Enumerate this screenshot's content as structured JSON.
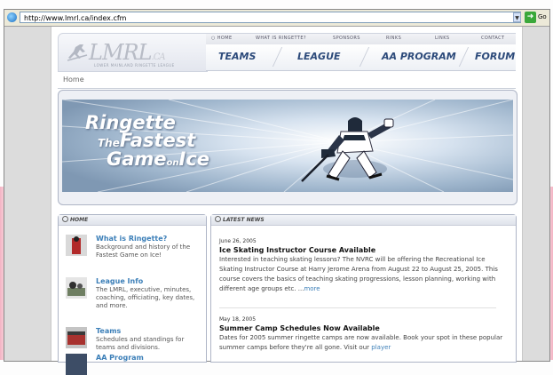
{
  "browser": {
    "address": "http://www.lmrl.ca/index.cfm",
    "go_label": "Go"
  },
  "header": {
    "logo_main": "LMRL",
    "logo_ca": ".CA",
    "logo_sub": "LOWER MAINLAND RINGETTE LEAGUE",
    "topnav": [
      "HOME",
      "WHAT IS RINGETTE?",
      "SPONSORS",
      "RINKS",
      "LINKS",
      "CONTACT"
    ],
    "mainnav": [
      "TEAMS",
      "LEAGUE",
      "AA PROGRAM",
      "FORUM"
    ]
  },
  "breadcrumb": "Home",
  "banner": {
    "line1": "Ringette",
    "line2_small": "The",
    "line2": "Fastest",
    "line3a": "Game",
    "line3_small": "on",
    "line3b": "Ice"
  },
  "home_panel": {
    "title": "HOME",
    "items": [
      {
        "title": "What is Ringette?",
        "desc": "Background and history of the Fastest Game on Ice!"
      },
      {
        "title": "League Info",
        "desc": "The LMRL, executive, minutes, coaching, officiating, key dates, and more."
      },
      {
        "title": "Teams",
        "desc": "Schedules and standings for teams and divisions."
      },
      {
        "title": "AA Program",
        "desc": ""
      }
    ]
  },
  "news_panel": {
    "title": "LATEST NEWS",
    "items": [
      {
        "date": "June 26, 2005",
        "title": "Ice Skating Instructor Course Available",
        "body": "Interested in teaching skating lessons? The NVRC will be offering the Recreational Ice Skating Instructor Course at Harry Jerome Arena from August 22 to August 25, 2005. This course covers the basics of teaching skating progressions, lesson planning, working with different age groups etc. ...",
        "more": "more"
      },
      {
        "date": "May 18, 2005",
        "title": "Summer Camp Schedules Now Available",
        "body": "Dates for 2005 summer ringette camps are now available. Book your spot in these popular summer camps before they're all gone. Visit our ",
        "more": "player"
      }
    ]
  },
  "colors": {
    "link": "#3c7fb8",
    "nav": "#2c4a7a",
    "banner_ice": "#b9cde2"
  }
}
